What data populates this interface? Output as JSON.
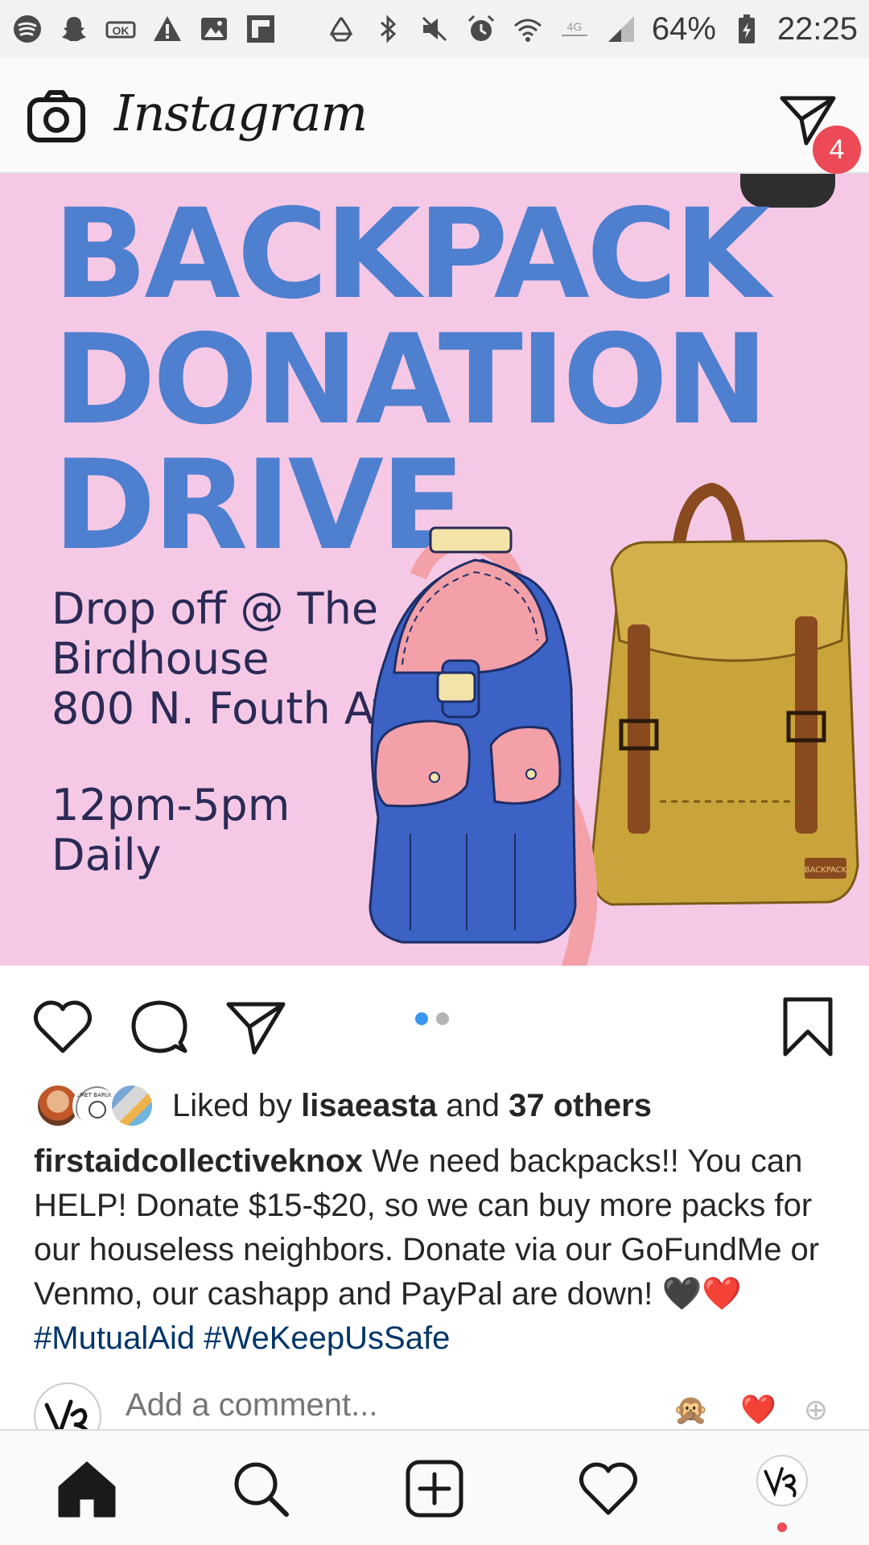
{
  "status_bar": {
    "battery": "64%",
    "time": "22:25",
    "left_icons": [
      "spotify-icon",
      "snapchat-icon",
      "ok-icon",
      "warning-icon",
      "gallery-icon",
      "flipboard-icon"
    ],
    "right_icons": [
      "recycle-icon",
      "bluetooth-icon",
      "mute-icon",
      "alarm-icon",
      "wifi-icon",
      "network-icon",
      "signal-icon",
      "battery-icon"
    ]
  },
  "header": {
    "logo": "Instagram",
    "dm_badge": "4"
  },
  "post": {
    "headline": [
      "BACKPACK",
      "DONATION",
      "DRIVE"
    ],
    "dropoff_lines": [
      "Drop off @ The",
      "Birdhouse",
      "800 N. Fouth Ave."
    ],
    "hours_lines": [
      "12pm-5pm",
      "Daily"
    ],
    "backpack_label": "BACKPACK",
    "carousel": {
      "total": 2,
      "active": 1
    }
  },
  "likes": {
    "prefix": "Liked by ",
    "user": "lisaeasta",
    "middle": " and ",
    "others": "37 others",
    "avatar_badge_text": "TEMET BARUGHA"
  },
  "caption": {
    "username": "firstaidcollectiveknox",
    "text": " We need backpacks!! You can HELP! Donate $15-$20, so we can buy more packs for our houseless neighbors. Donate via our GoFundMe or Venmo, our cashapp and PayPal are down! ",
    "emojis": "🖤❤️",
    "hashtags": " #MutualAid #WeKeepUsSafe"
  },
  "comment": {
    "placeholder": "Add a comment...",
    "quick_emojis": [
      "🙊",
      "❤️",
      "⊕"
    ]
  },
  "colors": {
    "post_bg": "#f5c9e6",
    "headline": "#4f7fcf",
    "badge": "#ed4956",
    "dot_active": "#3897f0",
    "hashtag": "#003569"
  }
}
